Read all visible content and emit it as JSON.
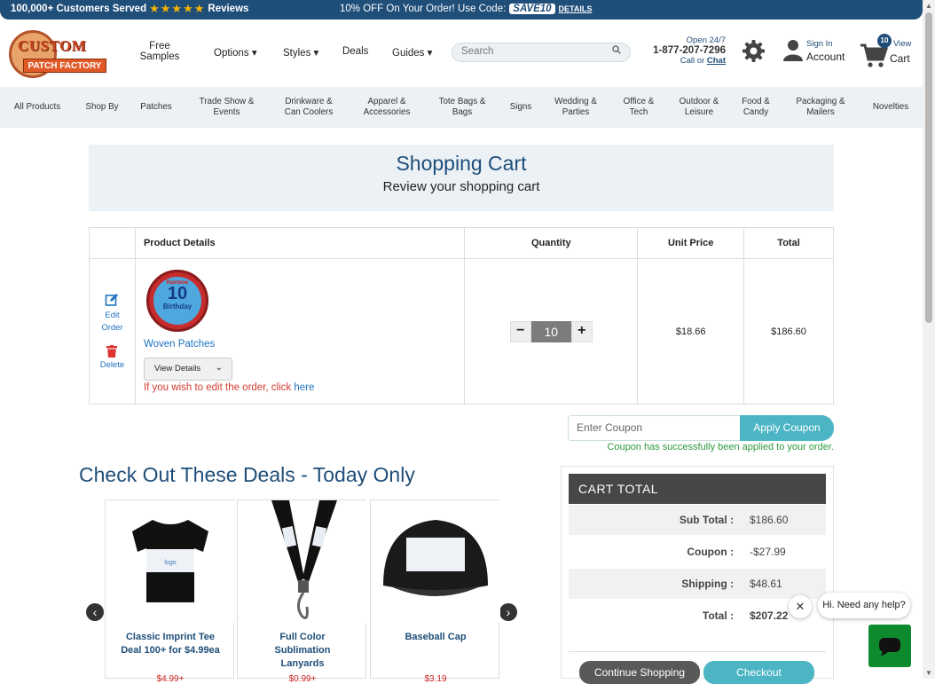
{
  "topbar": {
    "customers": "100,000+ Customers Served",
    "stars": "★★★★★",
    "reviews": "Reviews",
    "promo": "10% OFF On Your Order! Use Code:",
    "code": "SAVE10",
    "details": "DETAILS"
  },
  "header": {
    "logo_top": "CUSTOM",
    "logo_bottom": "PATCH FACTORY",
    "nav": {
      "free1": "Free",
      "free2": "Samples",
      "options": "Options ▾",
      "styles": "Styles ▾",
      "deals": "Deals",
      "guides": "Guides ▾"
    },
    "search_placeholder": "Search",
    "phone": {
      "open": "Open 24/7",
      "number": "1-877-207-7296",
      "call": "Call or",
      "chat": "Chat"
    },
    "account": {
      "signin": "Sign In",
      "account": "Account"
    },
    "cart": {
      "count": "10",
      "view": "View",
      "cart": "Cart"
    }
  },
  "categories": [
    "All Products",
    "Shop By",
    "Patches",
    "Trade Show & Events",
    "Drinkware & Can Coolers",
    "Apparel & Accessories",
    "Tote Bags & Bags",
    "Signs",
    "Wedding & Parties",
    "Office & Tech",
    "Outdoor & Leisure",
    "Food & Candy",
    "Packaging & Mailers",
    "Novelties"
  ],
  "banner": {
    "title": "Shopping Cart",
    "subtitle": "Review your shopping cart"
  },
  "table": {
    "headers": {
      "product": "Product Details",
      "quantity": "Quantity",
      "unit": "Unit Price",
      "total": "Total"
    },
    "edit": {
      "l1": "Edit",
      "l2": "Order",
      "delete": "Delete"
    },
    "patch": {
      "a": "Rainbow",
      "b": "10",
      "c": "Birthday"
    },
    "product_name": "Woven Patches",
    "view_details": "View Details",
    "edit_note": "If you wish to edit the order, click",
    "edit_here": "here",
    "qty": "10",
    "unit_price": "$18.66",
    "line_total": "$186.60"
  },
  "coupon": {
    "placeholder": "Enter Coupon",
    "button": "Apply Coupon",
    "msg": "Coupon has successfully been applied to your order."
  },
  "deals": {
    "title": "Check Out These Deals - Today Only",
    "items": [
      {
        "name1": "Classic Imprint Tee",
        "name2": "Deal 100+ for $4.99ea",
        "price": "$4.99+"
      },
      {
        "name1": "Full Color",
        "name2": "Sublimation",
        "name3": "Lanyards",
        "price": "$0.99+"
      },
      {
        "name1": "Baseball Cap",
        "price": "$3.19"
      }
    ]
  },
  "totals": {
    "head": "CART  TOTAL",
    "rows": [
      {
        "label": "Sub Total :",
        "value": "$186.60"
      },
      {
        "label": "Coupon :",
        "value": "-$27.99"
      },
      {
        "label": "Shipping :",
        "value": "$48.61"
      },
      {
        "label": "Total :",
        "value": "$207.22"
      }
    ],
    "continue": "Continue Shopping",
    "checkout": "Checkout"
  },
  "chat": {
    "close": "✕",
    "text": "Hi. Need any help?"
  }
}
